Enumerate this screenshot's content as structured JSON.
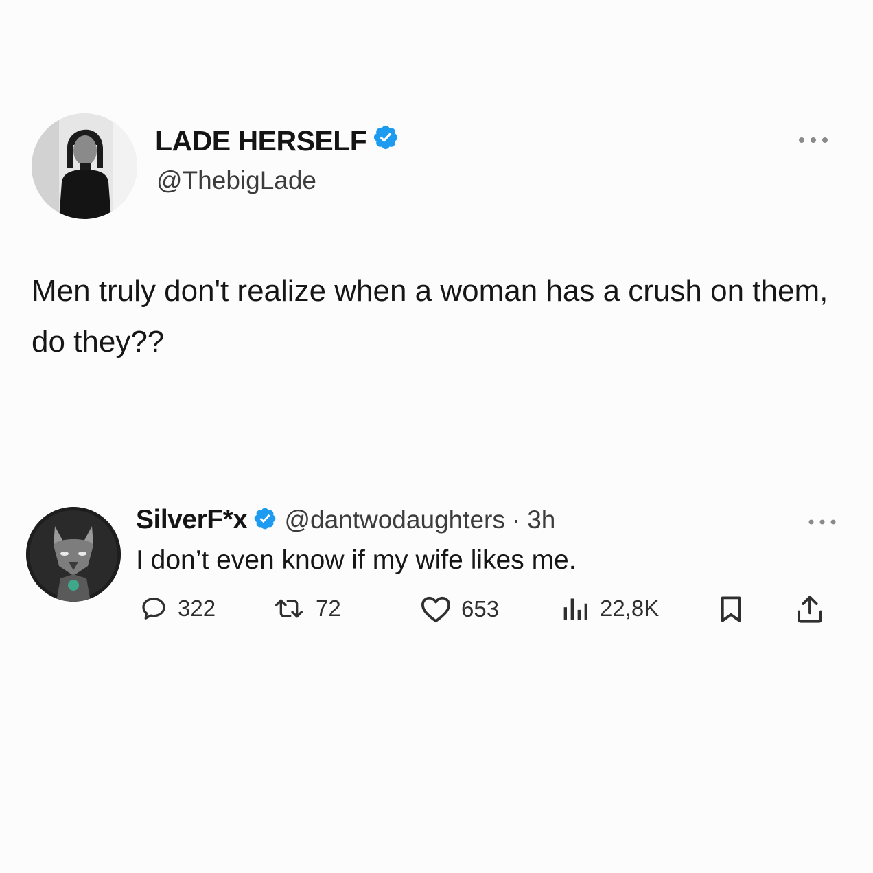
{
  "tweet": {
    "display_name": "LADE HERSELF",
    "handle": "@ThebigLade",
    "verified": true,
    "text": "Men truly don't realize when a woman has a crush on them, do they??",
    "avatar_icon": "woman-portrait-avatar",
    "more_icon": "more-dots-icon"
  },
  "reply": {
    "display_name": "SilverF*x",
    "handle": "@dantwodaughters",
    "separator": "·",
    "time": "3h",
    "verified": true,
    "text": "I don’t even know if my wife likes me.",
    "avatar_icon": "wolf-avatar",
    "actions": {
      "reply_count": "322",
      "retweet_count": "72",
      "like_count": "653",
      "view_count": "22,8K"
    }
  },
  "colors": {
    "background": "#fdfcfd",
    "verified_blue": "#1d9bf0",
    "text": "#141414",
    "muted": "#3c3c3c"
  }
}
